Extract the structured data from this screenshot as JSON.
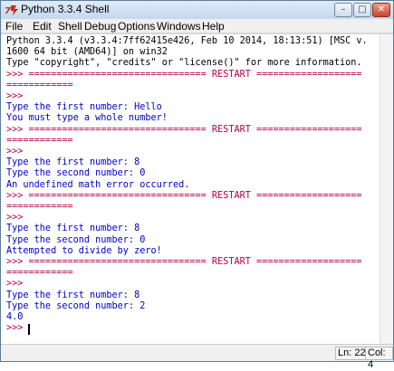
{
  "window": {
    "title": "Python 3.3.4 Shell",
    "controls": {
      "minimize": "–",
      "maximize": "□",
      "close": "✕"
    }
  },
  "menubar": {
    "items": [
      "File",
      "Edit",
      "Shell",
      "Debug",
      "Options",
      "Windows",
      "Help"
    ]
  },
  "shell": {
    "lines": [
      {
        "text": "Python 3.3.4 (v3.3.4:7ff62415e426, Feb 10 2014, 18:13:51) [MSC v.",
        "kind": "output"
      },
      {
        "text": "1600 64 bit (AMD64)] on win32",
        "kind": "output"
      },
      {
        "text": "Type \"copyright\", \"credits\" or \"license()\" for more information.",
        "kind": "output"
      },
      {
        "text": ">>> ================================ RESTART ===================",
        "kind": "restart"
      },
      {
        "text": "============",
        "kind": "restart"
      },
      {
        "text": ">>>",
        "kind": "prompt"
      },
      {
        "text": "Type the first number: Hello",
        "kind": "stdout"
      },
      {
        "text": "You must type a whole number!",
        "kind": "stdout"
      },
      {
        "text": ">>> ================================ RESTART ===================",
        "kind": "restart"
      },
      {
        "text": "============",
        "kind": "restart"
      },
      {
        "text": ">>>",
        "kind": "prompt"
      },
      {
        "text": "Type the first number: 8",
        "kind": "stdout"
      },
      {
        "text": "Type the second number: 0",
        "kind": "stdout"
      },
      {
        "text": "An undefined math error occurred.",
        "kind": "stdout"
      },
      {
        "text": ">>> ================================ RESTART ===================",
        "kind": "restart"
      },
      {
        "text": "============",
        "kind": "restart"
      },
      {
        "text": ">>>",
        "kind": "prompt"
      },
      {
        "text": "Type the first number: 8",
        "kind": "stdout"
      },
      {
        "text": "Type the second number: 0",
        "kind": "stdout"
      },
      {
        "text": "Attempted to divide by zero!",
        "kind": "stdout"
      },
      {
        "text": ">>> ================================ RESTART ===================",
        "kind": "restart"
      },
      {
        "text": "============",
        "kind": "restart"
      },
      {
        "text": ">>>",
        "kind": "prompt"
      },
      {
        "text": "Type the first number: 8",
        "kind": "stdout"
      },
      {
        "text": "Type the second number: 2",
        "kind": "stdout"
      },
      {
        "text": "4.0",
        "kind": "stdout"
      },
      {
        "text": ">>>",
        "kind": "prompt"
      }
    ]
  },
  "statusbar": {
    "line": "Ln: 22",
    "column": "Col: 4"
  },
  "colors": {
    "prompt": "#b5004a",
    "stdout": "#0000cc",
    "output": "#000000"
  },
  "icons": {
    "app": "python-tk-icon"
  }
}
